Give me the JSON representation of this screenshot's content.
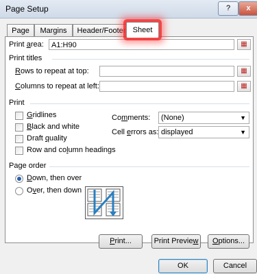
{
  "window": {
    "title": "Page Setup",
    "help": "?",
    "close": "x"
  },
  "tabs": [
    "Page",
    "Margins",
    "Header/Footer",
    "Sheet"
  ],
  "print_area": {
    "label_pre": "Print ",
    "label_key": "a",
    "label_post": "rea:",
    "value": "A1:H90"
  },
  "print_titles": {
    "title": "Print titles",
    "rows_label": {
      "key": "R",
      "post": "ows to repeat at top:"
    },
    "rows_value": "",
    "cols_label": {
      "key": "C",
      "post": "olumns to repeat at left:"
    },
    "cols_value": ""
  },
  "print": {
    "title": "Print",
    "gridlines": {
      "key": "G",
      "post": "ridlines"
    },
    "black_white": {
      "key": "B",
      "post": "lack and white"
    },
    "draft": {
      "pre": "Draft ",
      "key": "q",
      "post": "uality"
    },
    "row_col_headings": {
      "pre": "Row and co",
      "key": "l",
      "post": "umn headings"
    },
    "comments_label": {
      "pre": "Co",
      "key": "m",
      "post": "ments:"
    },
    "comments_value": "(None)",
    "cell_errors_label": {
      "pre": "Cell ",
      "key": "e",
      "post": "rrors as:"
    },
    "cell_errors_value": "displayed"
  },
  "page_order": {
    "title": "Page order",
    "down_then_over": {
      "key": "D",
      "post": "own, then over"
    },
    "over_then_down": {
      "pre": "O",
      "key": "v",
      "post": "er, then down"
    }
  },
  "buttons": {
    "print": {
      "key": "P",
      "post": "rint..."
    },
    "preview": {
      "pre": "Print Previe",
      "key": "w",
      "post": ""
    },
    "options": {
      "key": "O",
      "post": "ptions..."
    },
    "ok": "OK",
    "cancel": "Cancel"
  },
  "colors": {
    "highlight": "#f02828",
    "arrow": "#2a7fc0"
  },
  "icons": [
    "help-icon",
    "close-icon",
    "collapse-dialog-icon",
    "dropdown-arrow-icon",
    "page-order-icon"
  ]
}
